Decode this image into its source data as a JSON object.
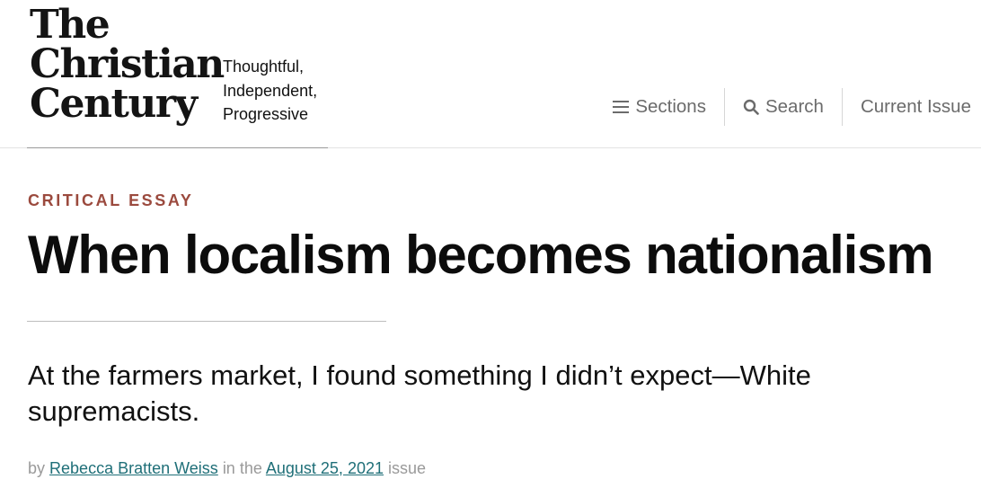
{
  "logo": {
    "line1": "The",
    "line2": "Christian",
    "line3": "Century"
  },
  "tagline": {
    "line1": "Thoughtful,",
    "line2": "Independent,",
    "line3": "Progressive"
  },
  "nav": {
    "sections": {
      "label": "Sections",
      "icon": "hamburger-menu-icon"
    },
    "search": {
      "label": "Search",
      "icon": "search-icon"
    },
    "current_issue": {
      "label": "Current Issue"
    }
  },
  "article": {
    "kicker": "CRITICAL ESSAY",
    "title": "When localism becomes nationalism",
    "dek": "At the farmers market, I found something I didn’t expect—White supremacists.",
    "byline": {
      "by": "by",
      "author": "Rebecca Bratten Weiss",
      "in_the": "in the",
      "issue_date": "August 25, 2021",
      "issue": "issue"
    }
  },
  "colors": {
    "kicker": "#9b4a3e",
    "link": "#1f6f78",
    "nav_text": "#6b6b6b",
    "muted": "#9a9a9a"
  }
}
